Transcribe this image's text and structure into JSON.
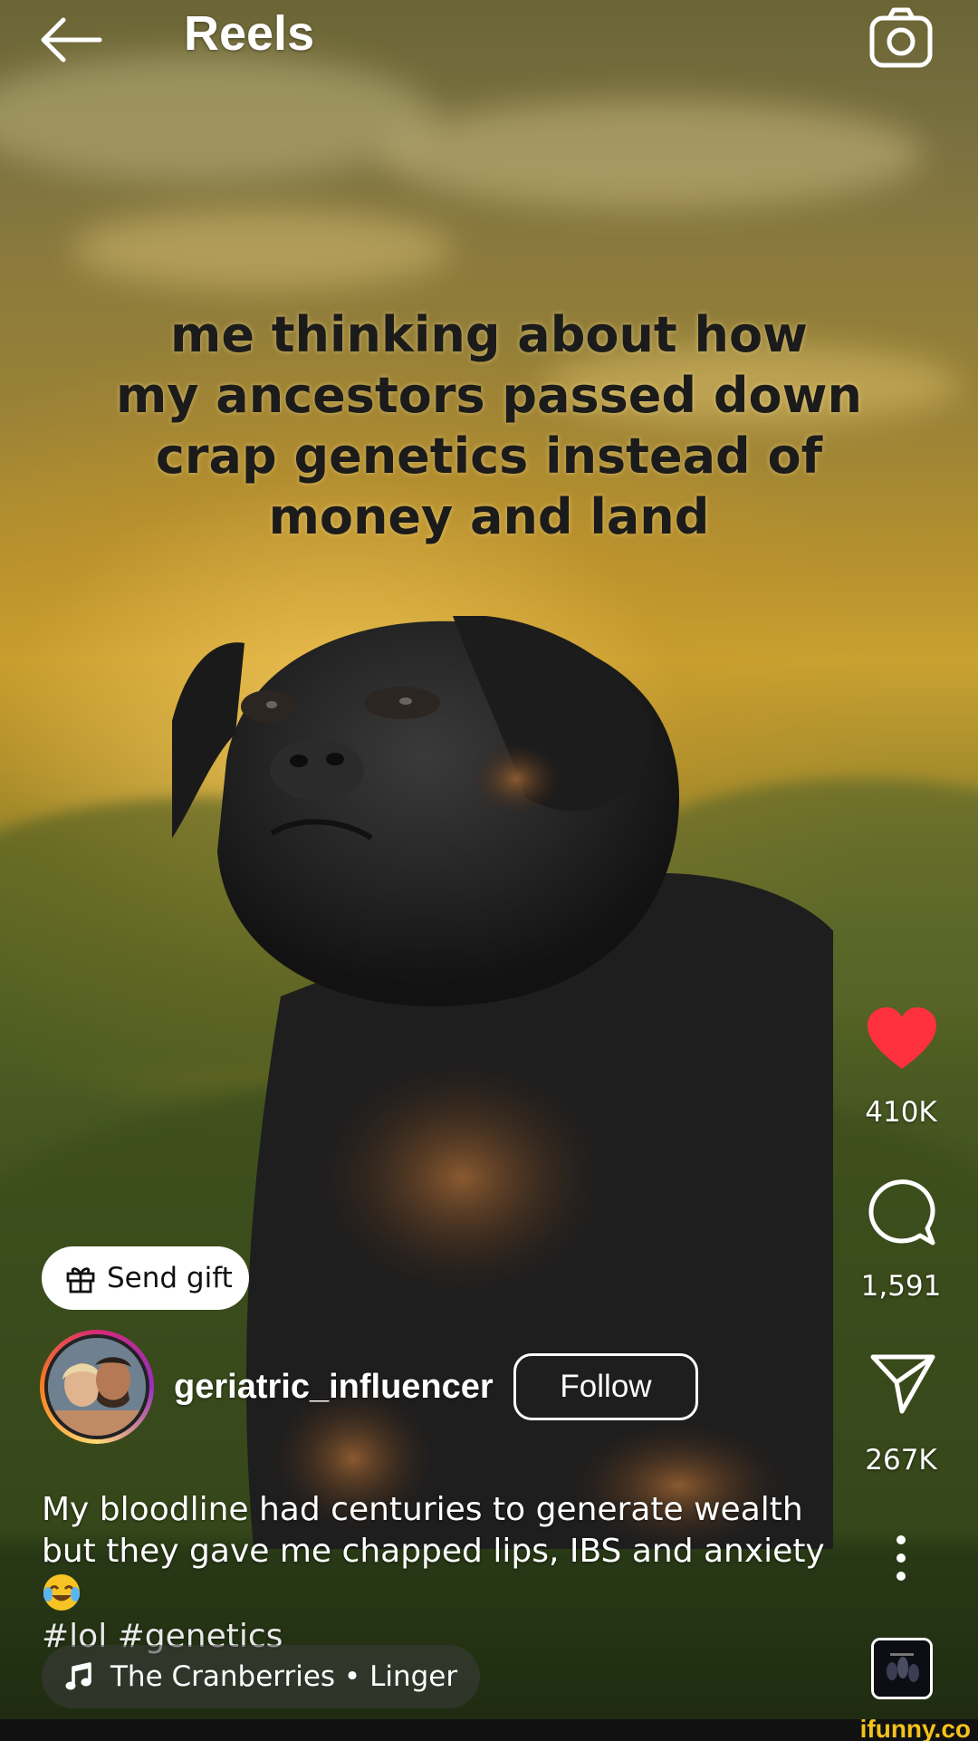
{
  "header": {
    "title": "Reels",
    "back_icon": "arrow-left-icon",
    "camera_icon": "camera-icon"
  },
  "video": {
    "overlay_text": "me thinking about how my ancestors passed down crap genetics instead of money and land",
    "overlay_lines": [
      "me thinking about how",
      "my ancestors passed down",
      "crap genetics instead of",
      "money and land"
    ]
  },
  "actions": {
    "like": {
      "icon": "heart-icon",
      "count": "410K",
      "color": "#ff3040"
    },
    "comment": {
      "icon": "comment-icon",
      "count": "1,591"
    },
    "share": {
      "icon": "send-icon",
      "count": "267K"
    },
    "more": {
      "icon": "more-vertical-icon"
    }
  },
  "gift": {
    "label": "Send gift",
    "icon": "gift-icon"
  },
  "author": {
    "username": "geriatric_influencer",
    "follow_label": "Follow"
  },
  "caption": {
    "text": "My bloodline had centuries to generate wealth but they gave me chapped lips, IBS and anxiety",
    "emoji": "😂",
    "hashtags": "#lol #genetics"
  },
  "audio": {
    "icon": "music-note-icon",
    "label": "The Cranberries • Linger"
  },
  "watermark": "ifunny.co"
}
